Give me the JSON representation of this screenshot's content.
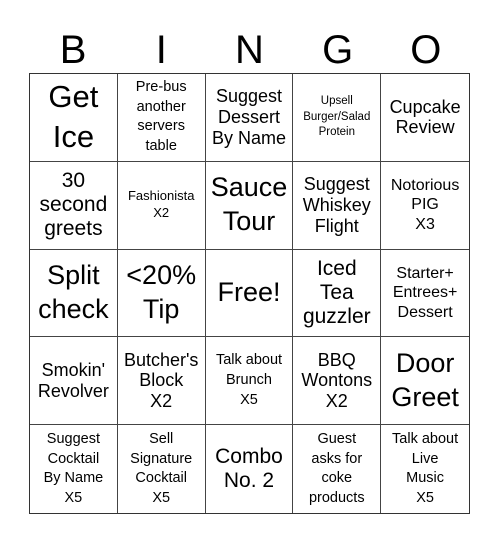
{
  "header": {
    "letters": [
      "B",
      "I",
      "N",
      "G",
      "O"
    ]
  },
  "cells": [
    {
      "text": "Get\nIce",
      "size": "s-xl"
    },
    {
      "text": "Pre-bus\nanother\nservers\ntable",
      "size": "s-s"
    },
    {
      "text": "Suggest\nDessert\nBy Name",
      "size": "s-m"
    },
    {
      "text": "Upsell\nBurger/Salad\nProtein",
      "size": "s-xxs"
    },
    {
      "text": "Cupcake\nReview",
      "size": "s-m"
    },
    {
      "text": "30\nsecond\ngreets",
      "size": "s-ml"
    },
    {
      "text": "Fashionista\nX2",
      "size": "s-xs"
    },
    {
      "text": "Sauce\nTour",
      "size": "s-l"
    },
    {
      "text": "Suggest\nWhiskey\nFlight",
      "size": "s-m"
    },
    {
      "text": "Notorious\nPIG\nX3",
      "size": "s-sm"
    },
    {
      "text": "Split\ncheck",
      "size": "s-l"
    },
    {
      "text": "<20%\nTip",
      "size": "s-l"
    },
    {
      "text": "Free!",
      "size": "s-l"
    },
    {
      "text": "Iced\nTea\nguzzler",
      "size": "s-ml"
    },
    {
      "text": "Starter+\nEntrees+\nDessert",
      "size": "s-sm"
    },
    {
      "text": "Smokin'\nRevolver",
      "size": "s-m"
    },
    {
      "text": "Butcher's\nBlock\nX2",
      "size": "s-m"
    },
    {
      "text": "Talk about\nBrunch\nX5",
      "size": "s-s"
    },
    {
      "text": "BBQ\nWontons\nX2",
      "size": "s-m"
    },
    {
      "text": "Door\nGreet",
      "size": "s-l"
    },
    {
      "text": "Suggest\nCocktail\nBy Name\nX5",
      "size": "s-s"
    },
    {
      "text": "Sell\nSignature\nCocktail\nX5",
      "size": "s-s"
    },
    {
      "text": "Combo\nNo. 2",
      "size": "s-ml"
    },
    {
      "text": "Guest\nasks for\ncoke\nproducts",
      "size": "s-s"
    },
    {
      "text": "Talk about\nLive\nMusic\nX5",
      "size": "s-s"
    }
  ]
}
